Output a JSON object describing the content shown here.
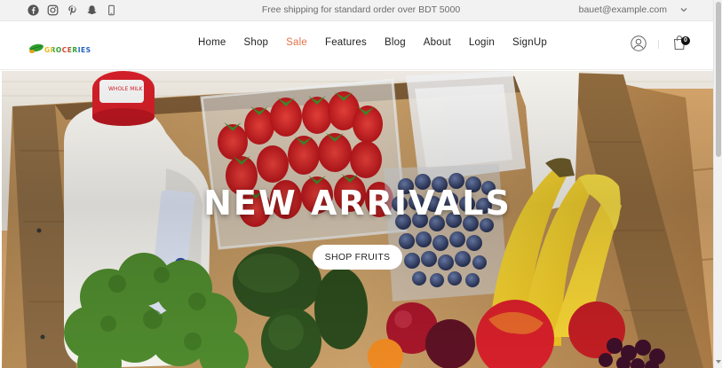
{
  "topbar": {
    "promo": "Free shipping for standard order over BDT 5000",
    "email": "bauet@example.com",
    "social_icons": [
      "facebook-icon",
      "instagram-icon",
      "pinterest-icon",
      "snapchat-icon",
      "mobile-icon"
    ]
  },
  "header": {
    "logo_text": "GROCERIES",
    "nav": [
      {
        "label": "Home"
      },
      {
        "label": "Shop"
      },
      {
        "label": "Sale",
        "active": true
      },
      {
        "label": "Features"
      },
      {
        "label": "Blog"
      },
      {
        "label": "About"
      },
      {
        "label": "Login"
      },
      {
        "label": "SignUp"
      }
    ],
    "cart_count": "0"
  },
  "hero": {
    "title": "NEW ARRIVALS",
    "button_label": "SHOP FRUITS"
  },
  "colors": {
    "accent": "#e8734a",
    "topbar_bg": "#f2f2f2",
    "text": "#222222"
  }
}
